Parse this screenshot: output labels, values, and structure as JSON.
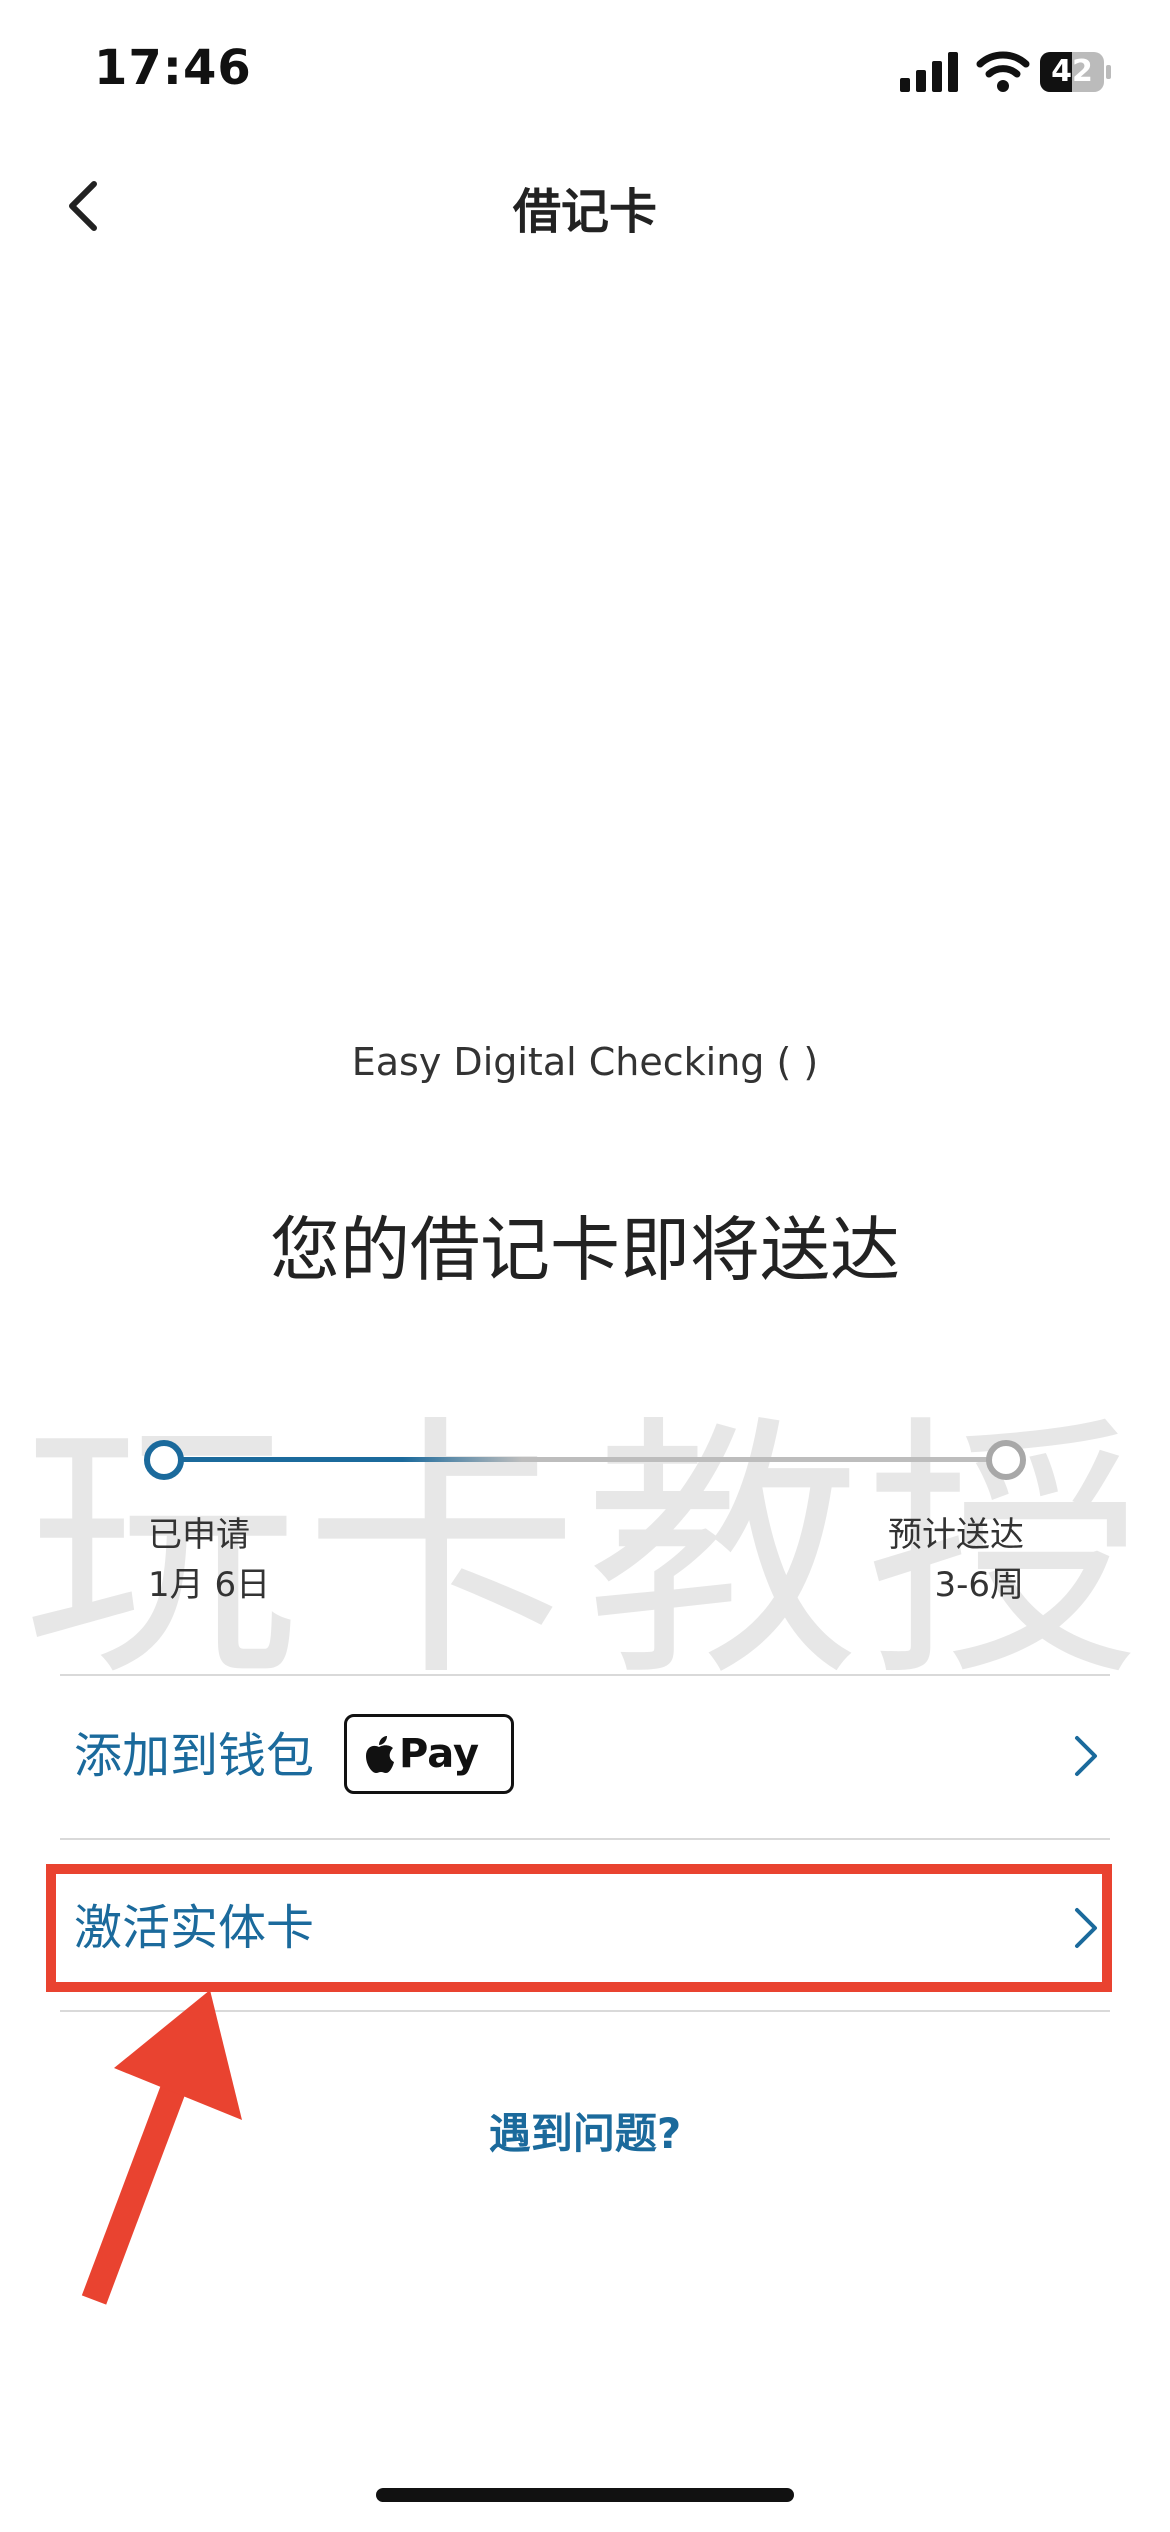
{
  "status_bar": {
    "time": "17:46",
    "battery": "42"
  },
  "nav": {
    "title": "借记卡"
  },
  "card": {
    "product_name": "Easy Digital Checking (          )"
  },
  "headline": "您的借记卡即将送达",
  "watermark": "玩卡教授",
  "progress": {
    "fraction": 0.25,
    "step_left": {
      "label": "已申请",
      "value": "1月 6日"
    },
    "step_right": {
      "label": "预计送达",
      "value": "3-6周"
    }
  },
  "rows": [
    {
      "label": "添加到钱包",
      "badge": "Pay"
    },
    {
      "label": "激活实体卡"
    }
  ],
  "help_link": "遇到问题?",
  "colors": {
    "accent": "#1b6a9c",
    "highlight": "#e94330",
    "divider": "#d9d9d9"
  }
}
